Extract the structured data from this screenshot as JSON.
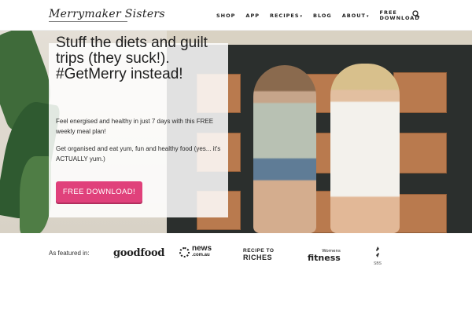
{
  "header": {
    "logo": "Merrymaker Sisters",
    "nav": [
      {
        "label": "SHOP"
      },
      {
        "label": "APP"
      },
      {
        "label": "RECIPES",
        "caret": "▾"
      },
      {
        "label": "BLOG"
      },
      {
        "label": "ABOUT",
        "caret": "▾"
      },
      {
        "label": "FREE DOWNLOAD"
      }
    ],
    "search_icon": "search-icon"
  },
  "hero": {
    "title": "Stuff the diets and guilt trips (they suck!). #GetMerry instead!",
    "paragraph1": "Feel energised and healthy in just 7 days with this FREE weekly meal plan!",
    "paragraph2": "Get organised and eat yum, fun and healthy food (yes... it's ACTUALLY yum.)",
    "cta_label": "FREE DOWNLOAD!",
    "cta_color": "#e0417b"
  },
  "featured": {
    "label": "As featured in:",
    "logos": {
      "goodfood": "goodfood",
      "news_main": "news",
      "news_sub": ".com.au",
      "recipe_line1": "RECIPE TO",
      "recipe_line2": "RICHES",
      "fitness_top": "Womens",
      "fitness_main": "fitness",
      "sbs": "SBS"
    }
  }
}
